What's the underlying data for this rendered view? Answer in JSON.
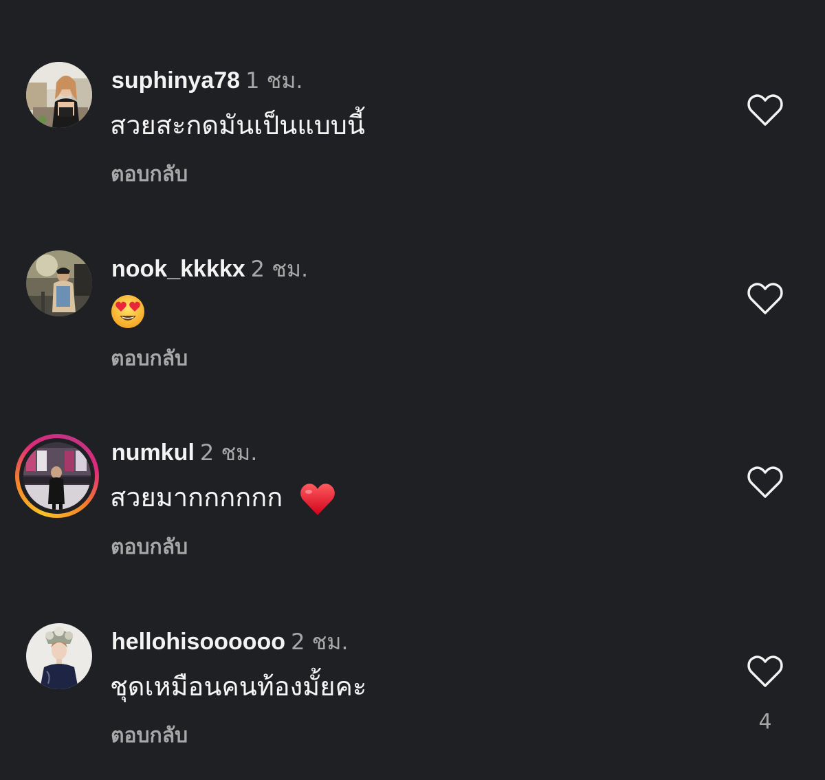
{
  "comments": [
    {
      "username": "suphinya78",
      "time": "1 ชม.",
      "text": "สวยสะกดมันเป็นแบบนี้",
      "reply_label": "ตอบกลับ",
      "avatar_icon": "profile-photo",
      "like_icon": "heart-outline-icon"
    },
    {
      "username": "nook_kkkkx",
      "time": "2 ชม.",
      "text": "",
      "emoji": "😍",
      "reply_label": "ตอบกลับ",
      "avatar_icon": "profile-photo",
      "like_icon": "heart-outline-icon"
    },
    {
      "username": "numkul",
      "time": "2 ชม.",
      "text": "สวยมากกกกกก",
      "emoji": "❤️",
      "reply_label": "ตอบกลับ",
      "avatar_icon": "profile-photo-story-ring",
      "like_icon": "heart-outline-icon"
    },
    {
      "username": "hellohisoooooo",
      "time": "2 ชม.",
      "text": "ชุดเหมือนคนท้องมั้ยคะ",
      "reply_label": "ตอบกลับ",
      "avatar_icon": "profile-photo",
      "like_icon": "heart-outline-icon",
      "like_count": "4"
    }
  ],
  "colors": {
    "background": "#1f2023",
    "primary_text": "#f3f3f3",
    "secondary_text": "#a8a8a8",
    "story_ring": [
      "#f9c226",
      "#f58529",
      "#dd2a7b",
      "#c13584"
    ]
  }
}
